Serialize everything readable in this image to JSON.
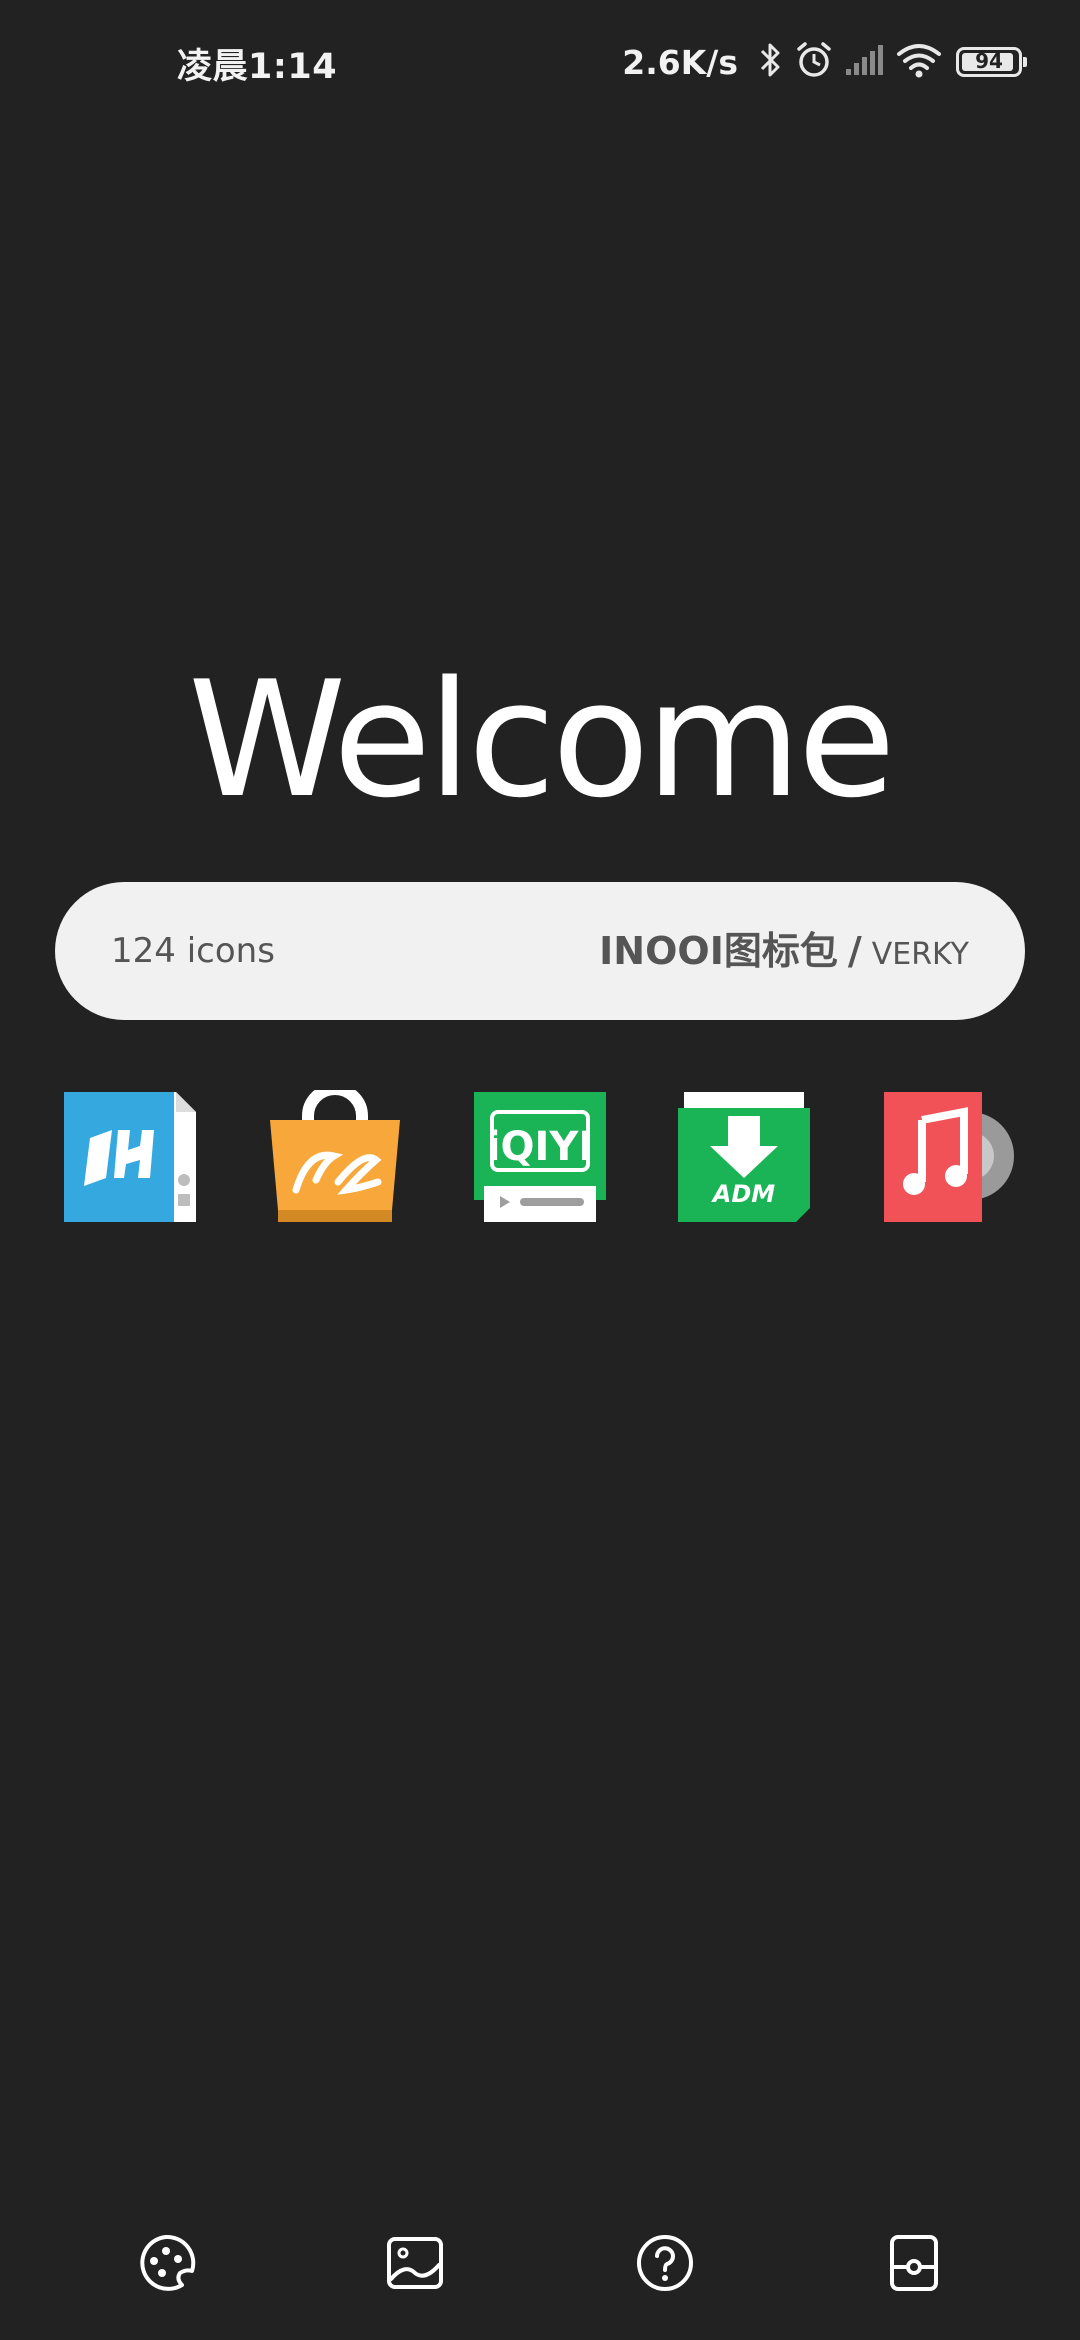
{
  "status_bar": {
    "time": "凌晨1:14",
    "net_speed": "2.6K/s",
    "battery_level": "94",
    "battery_fraction": 0.94,
    "icons": [
      "bluetooth-icon",
      "alarm-icon",
      "signal-icon",
      "wifi-icon",
      "battery-icon"
    ]
  },
  "welcome": {
    "title": "Welcome"
  },
  "info": {
    "icon_count": "124 icons",
    "pack_name": "INOOI图标包",
    "separator": "/",
    "author": "VERKY"
  },
  "preview_icons": [
    {
      "name": "wps-app-icon",
      "color": "#35a8e0"
    },
    {
      "name": "aliexpress-app-icon",
      "color": "#f8a73b"
    },
    {
      "name": "iqiyi-app-icon",
      "color": "#1ab356"
    },
    {
      "name": "adm-download-app-icon",
      "color": "#1ab356"
    },
    {
      "name": "music-app-icon",
      "color": "#f15257"
    }
  ],
  "bottom_nav": [
    {
      "name": "icons-nav",
      "icon": "palette-icon"
    },
    {
      "name": "wallpapers-nav",
      "icon": "image-icon"
    },
    {
      "name": "help-nav",
      "icon": "question-icon"
    },
    {
      "name": "apply-nav",
      "icon": "phone-icon"
    }
  ],
  "colors": {
    "background": "#222222",
    "pill": "#f1f1f1",
    "pill_text": "#555555",
    "text": "#ffffff"
  }
}
